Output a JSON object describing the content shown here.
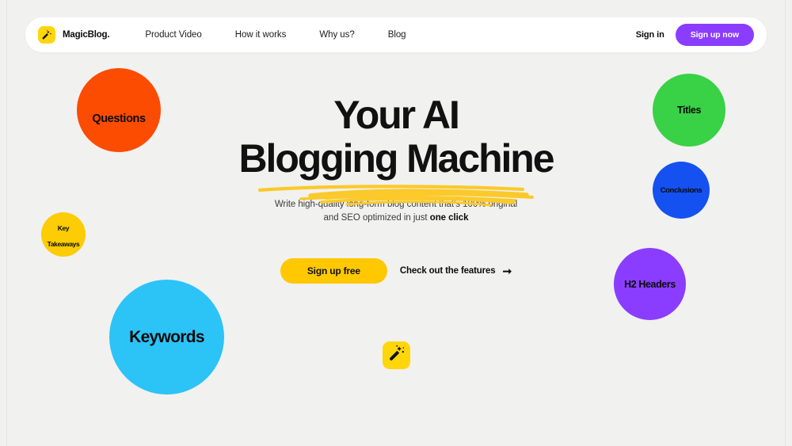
{
  "page": {
    "background_color": "#f1f1f0"
  },
  "navbar": {
    "brand": {
      "name": "MagicBlog.",
      "icon": "magic-wand-icon",
      "mark_color": "#ffd60a"
    },
    "links": [
      {
        "label": "Product Video"
      },
      {
        "label": "How it works"
      },
      {
        "label": "Why us?"
      },
      {
        "label": "Blog"
      }
    ],
    "sign_in_label": "Sign in",
    "sign_up_label": "Sign up now",
    "sign_up_color": "#8b3dff"
  },
  "hero": {
    "title_line1": "Your AI",
    "title_line2": "Blogging Machine",
    "underline_color": "#fbc92a",
    "subtitle_part1": "Write high-quality long-form blog content that's 100% original",
    "subtitle_part2": "and SEO optimized in just ",
    "subtitle_emphasis": "one click",
    "primary_cta_label": "Sign up free",
    "primary_cta_color": "#ffc800",
    "secondary_cta_label": "Check out the features",
    "secondary_cta_icon": "arrow-right-icon"
  },
  "bubbles": [
    {
      "label": "Questions",
      "color": "#fc4c02"
    },
    {
      "label": "Key\nTakeaways",
      "line1": "Key",
      "line2": "Takeaways",
      "color": "#fccc04"
    },
    {
      "label": "Keywords",
      "color": "#2cc3f7"
    },
    {
      "label": "Titles",
      "color": "#39d145"
    },
    {
      "label": "Conclusions",
      "color": "#1451f0"
    },
    {
      "label": "H2 Headers",
      "color": "#8b3dff"
    }
  ],
  "wand_badge": {
    "icon": "magic-wand-icon",
    "color": "#ffd60a"
  }
}
